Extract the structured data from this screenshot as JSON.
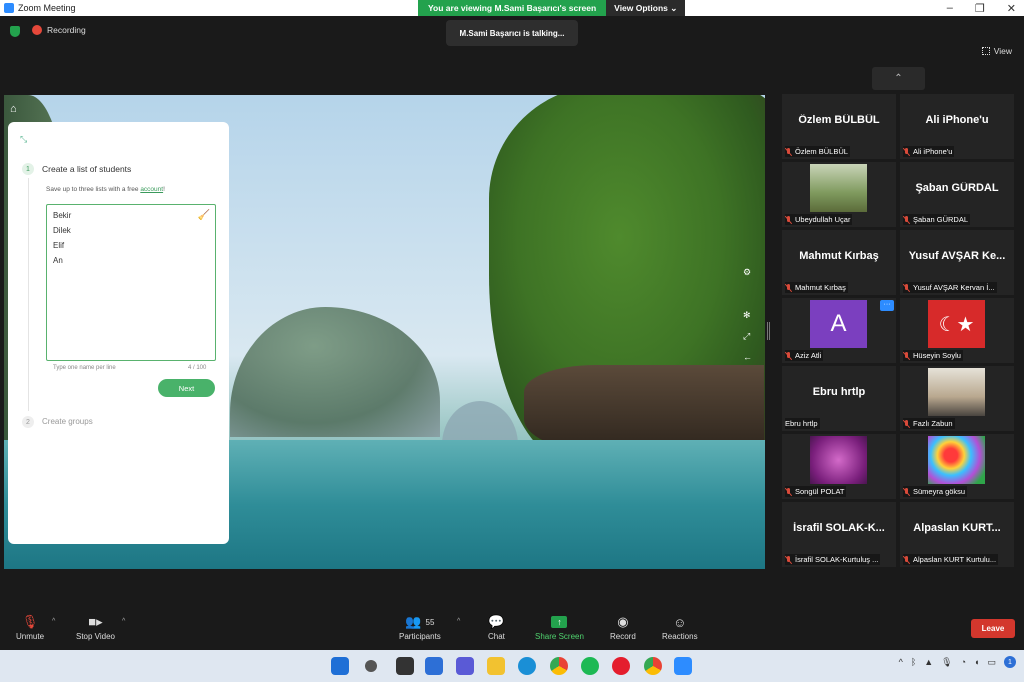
{
  "window": {
    "title": "Zoom Meeting"
  },
  "share_banner": {
    "text": "You are viewing M.Sami Başarıcı's screen",
    "view_options": "View Options ⌄"
  },
  "status": {
    "recording": "Recording",
    "talking": "M.Sami Başarıcı is talking...",
    "view": "View"
  },
  "shared_app": {
    "step1_title": "Create a list of students",
    "step1_num": "1",
    "save_note_prefix": "Save up to three lists with a free ",
    "save_note_link": "account",
    "save_note_suffix": "!",
    "names": [
      "Bekir",
      "Dilek",
      "Elif",
      "An"
    ],
    "hint": "Type one name per line",
    "count": "4 / 100",
    "next": "Next",
    "step2_title": "Create groups",
    "step2_num": "2"
  },
  "gallery": [
    {
      "big": "Özlem BÜLBÜL",
      "label": "Özlem BÜLBÜL"
    },
    {
      "big": "Ali iPhone'u",
      "label": "Ali iPhone'u"
    },
    {
      "big": "",
      "label": "Ubeydullah Uçar",
      "image": "landscape"
    },
    {
      "big": "Şaban GÜRDAL",
      "label": "Şaban GÜRDAL"
    },
    {
      "big": "Mahmut Kırbaş",
      "label": "Mahmut Kırbaş"
    },
    {
      "big": "Yusuf AVŞAR Ke...",
      "label": "Yusuf AVŞAR Kervan İ..."
    },
    {
      "big": "",
      "label": "Aziz Atli",
      "avatar_letter": "A",
      "more": "···"
    },
    {
      "big": "",
      "label": "Hüseyin Soylu",
      "image": "turkish-flag"
    },
    {
      "big": "Ebru hrtlp",
      "label": "Ebru hrtlp",
      "unmuted": true
    },
    {
      "big": "",
      "label": "Fazlı Zabun",
      "image": "person"
    },
    {
      "big": "",
      "label": "Songül POLAT",
      "image": "flowers-pink"
    },
    {
      "big": "",
      "label": "Sümeyra göksu",
      "image": "flowers-colorful"
    },
    {
      "big": "İsrafil SOLAK-K...",
      "label": "İsrafil SOLAK-Kurtuluş ..."
    },
    {
      "big": "Alpaslan KURT...",
      "label": "Alpaslan KURT Kurtulu..."
    }
  ],
  "toolbar": {
    "unmute": "Unmute",
    "stop_video": "Stop Video",
    "participants": "Participants",
    "participants_count": "55",
    "chat": "Chat",
    "share_screen": "Share Screen",
    "record": "Record",
    "reactions": "Reactions",
    "leave": "Leave"
  },
  "colors": {
    "accent_green": "#23a24d",
    "leave_red": "#d3372d",
    "zoom_blue": "#2d8cff"
  }
}
